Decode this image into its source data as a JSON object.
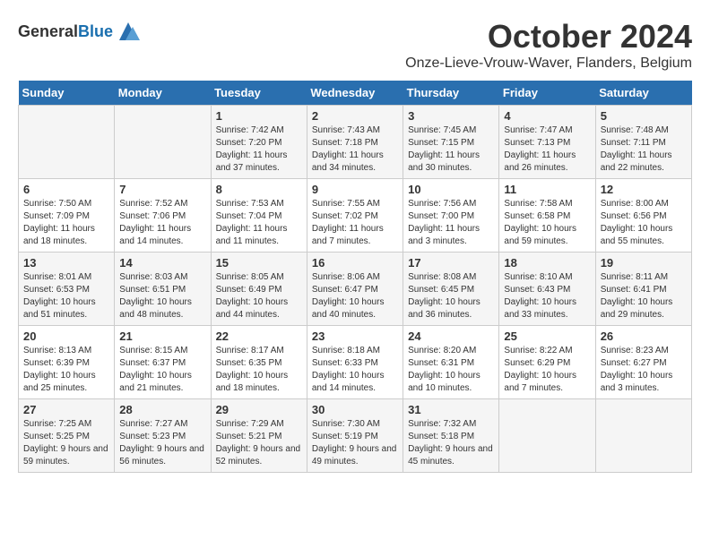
{
  "header": {
    "logo_general": "General",
    "logo_blue": "Blue",
    "title": "October 2024",
    "subtitle": "Onze-Lieve-Vrouw-Waver, Flanders, Belgium"
  },
  "weekdays": [
    "Sunday",
    "Monday",
    "Tuesday",
    "Wednesday",
    "Thursday",
    "Friday",
    "Saturday"
  ],
  "weeks": [
    [
      {
        "day": "",
        "sunrise": "",
        "sunset": "",
        "daylight": ""
      },
      {
        "day": "",
        "sunrise": "",
        "sunset": "",
        "daylight": ""
      },
      {
        "day": "1",
        "sunrise": "Sunrise: 7:42 AM",
        "sunset": "Sunset: 7:20 PM",
        "daylight": "Daylight: 11 hours and 37 minutes."
      },
      {
        "day": "2",
        "sunrise": "Sunrise: 7:43 AM",
        "sunset": "Sunset: 7:18 PM",
        "daylight": "Daylight: 11 hours and 34 minutes."
      },
      {
        "day": "3",
        "sunrise": "Sunrise: 7:45 AM",
        "sunset": "Sunset: 7:15 PM",
        "daylight": "Daylight: 11 hours and 30 minutes."
      },
      {
        "day": "4",
        "sunrise": "Sunrise: 7:47 AM",
        "sunset": "Sunset: 7:13 PM",
        "daylight": "Daylight: 11 hours and 26 minutes."
      },
      {
        "day": "5",
        "sunrise": "Sunrise: 7:48 AM",
        "sunset": "Sunset: 7:11 PM",
        "daylight": "Daylight: 11 hours and 22 minutes."
      }
    ],
    [
      {
        "day": "6",
        "sunrise": "Sunrise: 7:50 AM",
        "sunset": "Sunset: 7:09 PM",
        "daylight": "Daylight: 11 hours and 18 minutes."
      },
      {
        "day": "7",
        "sunrise": "Sunrise: 7:52 AM",
        "sunset": "Sunset: 7:06 PM",
        "daylight": "Daylight: 11 hours and 14 minutes."
      },
      {
        "day": "8",
        "sunrise": "Sunrise: 7:53 AM",
        "sunset": "Sunset: 7:04 PM",
        "daylight": "Daylight: 11 hours and 11 minutes."
      },
      {
        "day": "9",
        "sunrise": "Sunrise: 7:55 AM",
        "sunset": "Sunset: 7:02 PM",
        "daylight": "Daylight: 11 hours and 7 minutes."
      },
      {
        "day": "10",
        "sunrise": "Sunrise: 7:56 AM",
        "sunset": "Sunset: 7:00 PM",
        "daylight": "Daylight: 11 hours and 3 minutes."
      },
      {
        "day": "11",
        "sunrise": "Sunrise: 7:58 AM",
        "sunset": "Sunset: 6:58 PM",
        "daylight": "Daylight: 10 hours and 59 minutes."
      },
      {
        "day": "12",
        "sunrise": "Sunrise: 8:00 AM",
        "sunset": "Sunset: 6:56 PM",
        "daylight": "Daylight: 10 hours and 55 minutes."
      }
    ],
    [
      {
        "day": "13",
        "sunrise": "Sunrise: 8:01 AM",
        "sunset": "Sunset: 6:53 PM",
        "daylight": "Daylight: 10 hours and 51 minutes."
      },
      {
        "day": "14",
        "sunrise": "Sunrise: 8:03 AM",
        "sunset": "Sunset: 6:51 PM",
        "daylight": "Daylight: 10 hours and 48 minutes."
      },
      {
        "day": "15",
        "sunrise": "Sunrise: 8:05 AM",
        "sunset": "Sunset: 6:49 PM",
        "daylight": "Daylight: 10 hours and 44 minutes."
      },
      {
        "day": "16",
        "sunrise": "Sunrise: 8:06 AM",
        "sunset": "Sunset: 6:47 PM",
        "daylight": "Daylight: 10 hours and 40 minutes."
      },
      {
        "day": "17",
        "sunrise": "Sunrise: 8:08 AM",
        "sunset": "Sunset: 6:45 PM",
        "daylight": "Daylight: 10 hours and 36 minutes."
      },
      {
        "day": "18",
        "sunrise": "Sunrise: 8:10 AM",
        "sunset": "Sunset: 6:43 PM",
        "daylight": "Daylight: 10 hours and 33 minutes."
      },
      {
        "day": "19",
        "sunrise": "Sunrise: 8:11 AM",
        "sunset": "Sunset: 6:41 PM",
        "daylight": "Daylight: 10 hours and 29 minutes."
      }
    ],
    [
      {
        "day": "20",
        "sunrise": "Sunrise: 8:13 AM",
        "sunset": "Sunset: 6:39 PM",
        "daylight": "Daylight: 10 hours and 25 minutes."
      },
      {
        "day": "21",
        "sunrise": "Sunrise: 8:15 AM",
        "sunset": "Sunset: 6:37 PM",
        "daylight": "Daylight: 10 hours and 21 minutes."
      },
      {
        "day": "22",
        "sunrise": "Sunrise: 8:17 AM",
        "sunset": "Sunset: 6:35 PM",
        "daylight": "Daylight: 10 hours and 18 minutes."
      },
      {
        "day": "23",
        "sunrise": "Sunrise: 8:18 AM",
        "sunset": "Sunset: 6:33 PM",
        "daylight": "Daylight: 10 hours and 14 minutes."
      },
      {
        "day": "24",
        "sunrise": "Sunrise: 8:20 AM",
        "sunset": "Sunset: 6:31 PM",
        "daylight": "Daylight: 10 hours and 10 minutes."
      },
      {
        "day": "25",
        "sunrise": "Sunrise: 8:22 AM",
        "sunset": "Sunset: 6:29 PM",
        "daylight": "Daylight: 10 hours and 7 minutes."
      },
      {
        "day": "26",
        "sunrise": "Sunrise: 8:23 AM",
        "sunset": "Sunset: 6:27 PM",
        "daylight": "Daylight: 10 hours and 3 minutes."
      }
    ],
    [
      {
        "day": "27",
        "sunrise": "Sunrise: 7:25 AM",
        "sunset": "Sunset: 5:25 PM",
        "daylight": "Daylight: 9 hours and 59 minutes."
      },
      {
        "day": "28",
        "sunrise": "Sunrise: 7:27 AM",
        "sunset": "Sunset: 5:23 PM",
        "daylight": "Daylight: 9 hours and 56 minutes."
      },
      {
        "day": "29",
        "sunrise": "Sunrise: 7:29 AM",
        "sunset": "Sunset: 5:21 PM",
        "daylight": "Daylight: 9 hours and 52 minutes."
      },
      {
        "day": "30",
        "sunrise": "Sunrise: 7:30 AM",
        "sunset": "Sunset: 5:19 PM",
        "daylight": "Daylight: 9 hours and 49 minutes."
      },
      {
        "day": "31",
        "sunrise": "Sunrise: 7:32 AM",
        "sunset": "Sunset: 5:18 PM",
        "daylight": "Daylight: 9 hours and 45 minutes."
      },
      {
        "day": "",
        "sunrise": "",
        "sunset": "",
        "daylight": ""
      },
      {
        "day": "",
        "sunrise": "",
        "sunset": "",
        "daylight": ""
      }
    ]
  ]
}
